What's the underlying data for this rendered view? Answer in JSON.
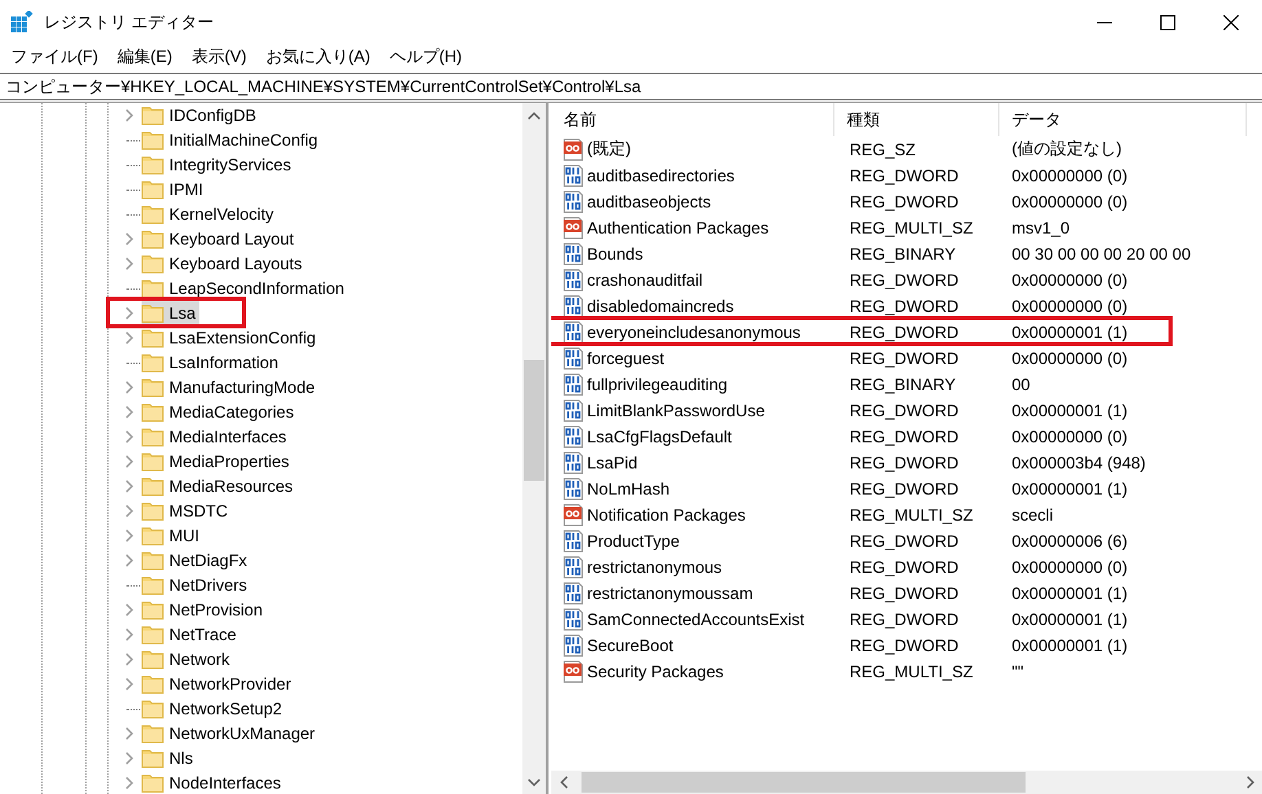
{
  "window": {
    "title": "レジストリ エディター"
  },
  "menu": [
    "ファイル(F)",
    "編集(E)",
    "表示(V)",
    "お気に入り(A)",
    "ヘルプ(H)"
  ],
  "address": "コンピューター¥HKEY_LOCAL_MACHINE¥SYSTEM¥CurrentControlSet¥Control¥Lsa",
  "tree": [
    {
      "label": "IDConfigDB",
      "expandable": true,
      "selected": false,
      "highlighted": false
    },
    {
      "label": "InitialMachineConfig",
      "expandable": false,
      "selected": false,
      "highlighted": false
    },
    {
      "label": "IntegrityServices",
      "expandable": false,
      "selected": false,
      "highlighted": false
    },
    {
      "label": "IPMI",
      "expandable": false,
      "selected": false,
      "highlighted": false
    },
    {
      "label": "KernelVelocity",
      "expandable": false,
      "selected": false,
      "highlighted": false
    },
    {
      "label": "Keyboard Layout",
      "expandable": true,
      "selected": false,
      "highlighted": false
    },
    {
      "label": "Keyboard Layouts",
      "expandable": true,
      "selected": false,
      "highlighted": false
    },
    {
      "label": "LeapSecondInformation",
      "expandable": false,
      "selected": false,
      "highlighted": false
    },
    {
      "label": "Lsa",
      "expandable": true,
      "selected": true,
      "highlighted": true
    },
    {
      "label": "LsaExtensionConfig",
      "expandable": true,
      "selected": false,
      "highlighted": false
    },
    {
      "label": "LsaInformation",
      "expandable": false,
      "selected": false,
      "highlighted": false
    },
    {
      "label": "ManufacturingMode",
      "expandable": true,
      "selected": false,
      "highlighted": false
    },
    {
      "label": "MediaCategories",
      "expandable": true,
      "selected": false,
      "highlighted": false
    },
    {
      "label": "MediaInterfaces",
      "expandable": true,
      "selected": false,
      "highlighted": false
    },
    {
      "label": "MediaProperties",
      "expandable": true,
      "selected": false,
      "highlighted": false
    },
    {
      "label": "MediaResources",
      "expandable": true,
      "selected": false,
      "highlighted": false
    },
    {
      "label": "MSDTC",
      "expandable": true,
      "selected": false,
      "highlighted": false
    },
    {
      "label": "MUI",
      "expandable": true,
      "selected": false,
      "highlighted": false
    },
    {
      "label": "NetDiagFx",
      "expandable": true,
      "selected": false,
      "highlighted": false
    },
    {
      "label": "NetDrivers",
      "expandable": false,
      "selected": false,
      "highlighted": false
    },
    {
      "label": "NetProvision",
      "expandable": true,
      "selected": false,
      "highlighted": false
    },
    {
      "label": "NetTrace",
      "expandable": true,
      "selected": false,
      "highlighted": false
    },
    {
      "label": "Network",
      "expandable": true,
      "selected": false,
      "highlighted": false
    },
    {
      "label": "NetworkProvider",
      "expandable": true,
      "selected": false,
      "highlighted": false
    },
    {
      "label": "NetworkSetup2",
      "expandable": false,
      "selected": false,
      "highlighted": false
    },
    {
      "label": "NetworkUxManager",
      "expandable": true,
      "selected": false,
      "highlighted": false
    },
    {
      "label": "Nls",
      "expandable": true,
      "selected": false,
      "highlighted": false
    },
    {
      "label": "NodeInterfaces",
      "expandable": true,
      "selected": false,
      "highlighted": false
    }
  ],
  "table": {
    "columns": [
      "名前",
      "種類",
      "データ"
    ],
    "rows": [
      {
        "kind": "string",
        "name": "(既定)",
        "type": "REG_SZ",
        "data": "(値の設定なし)",
        "highlighted": false
      },
      {
        "kind": "binary",
        "name": "auditbasedirectories",
        "type": "REG_DWORD",
        "data": "0x00000000 (0)",
        "highlighted": false
      },
      {
        "kind": "binary",
        "name": "auditbaseobjects",
        "type": "REG_DWORD",
        "data": "0x00000000 (0)",
        "highlighted": false
      },
      {
        "kind": "string",
        "name": "Authentication Packages",
        "type": "REG_MULTI_SZ",
        "data": "msv1_0",
        "highlighted": false
      },
      {
        "kind": "binary",
        "name": "Bounds",
        "type": "REG_BINARY",
        "data": "00 30 00 00 00 20 00 00",
        "highlighted": false
      },
      {
        "kind": "binary",
        "name": "crashonauditfail",
        "type": "REG_DWORD",
        "data": "0x00000000 (0)",
        "highlighted": false
      },
      {
        "kind": "binary",
        "name": "disabledomaincreds",
        "type": "REG_DWORD",
        "data": "0x00000000 (0)",
        "highlighted": false
      },
      {
        "kind": "binary",
        "name": "everyoneincludesanonymous",
        "type": "REG_DWORD",
        "data": "0x00000001 (1)",
        "highlighted": true
      },
      {
        "kind": "binary",
        "name": "forceguest",
        "type": "REG_DWORD",
        "data": "0x00000000 (0)",
        "highlighted": false
      },
      {
        "kind": "binary",
        "name": "fullprivilegeauditing",
        "type": "REG_BINARY",
        "data": "00",
        "highlighted": false
      },
      {
        "kind": "binary",
        "name": "LimitBlankPasswordUse",
        "type": "REG_DWORD",
        "data": "0x00000001 (1)",
        "highlighted": false
      },
      {
        "kind": "binary",
        "name": "LsaCfgFlagsDefault",
        "type": "REG_DWORD",
        "data": "0x00000000 (0)",
        "highlighted": false
      },
      {
        "kind": "binary",
        "name": "LsaPid",
        "type": "REG_DWORD",
        "data": "0x000003b4 (948)",
        "highlighted": false
      },
      {
        "kind": "binary",
        "name": "NoLmHash",
        "type": "REG_DWORD",
        "data": "0x00000001 (1)",
        "highlighted": false
      },
      {
        "kind": "string",
        "name": "Notification Packages",
        "type": "REG_MULTI_SZ",
        "data": "scecli",
        "highlighted": false
      },
      {
        "kind": "binary",
        "name": "ProductType",
        "type": "REG_DWORD",
        "data": "0x00000006 (6)",
        "highlighted": false
      },
      {
        "kind": "binary",
        "name": "restrictanonymous",
        "type": "REG_DWORD",
        "data": "0x00000000 (0)",
        "highlighted": false
      },
      {
        "kind": "binary",
        "name": "restrictanonymoussam",
        "type": "REG_DWORD",
        "data": "0x00000001 (1)",
        "highlighted": false
      },
      {
        "kind": "binary",
        "name": "SamConnectedAccountsExist",
        "type": "REG_DWORD",
        "data": "0x00000001 (1)",
        "highlighted": false
      },
      {
        "kind": "binary",
        "name": "SecureBoot",
        "type": "REG_DWORD",
        "data": "0x00000001 (1)",
        "highlighted": false
      },
      {
        "kind": "string",
        "name": "Security Packages",
        "type": "REG_MULTI_SZ",
        "data": "\"\"",
        "highlighted": false
      }
    ]
  }
}
